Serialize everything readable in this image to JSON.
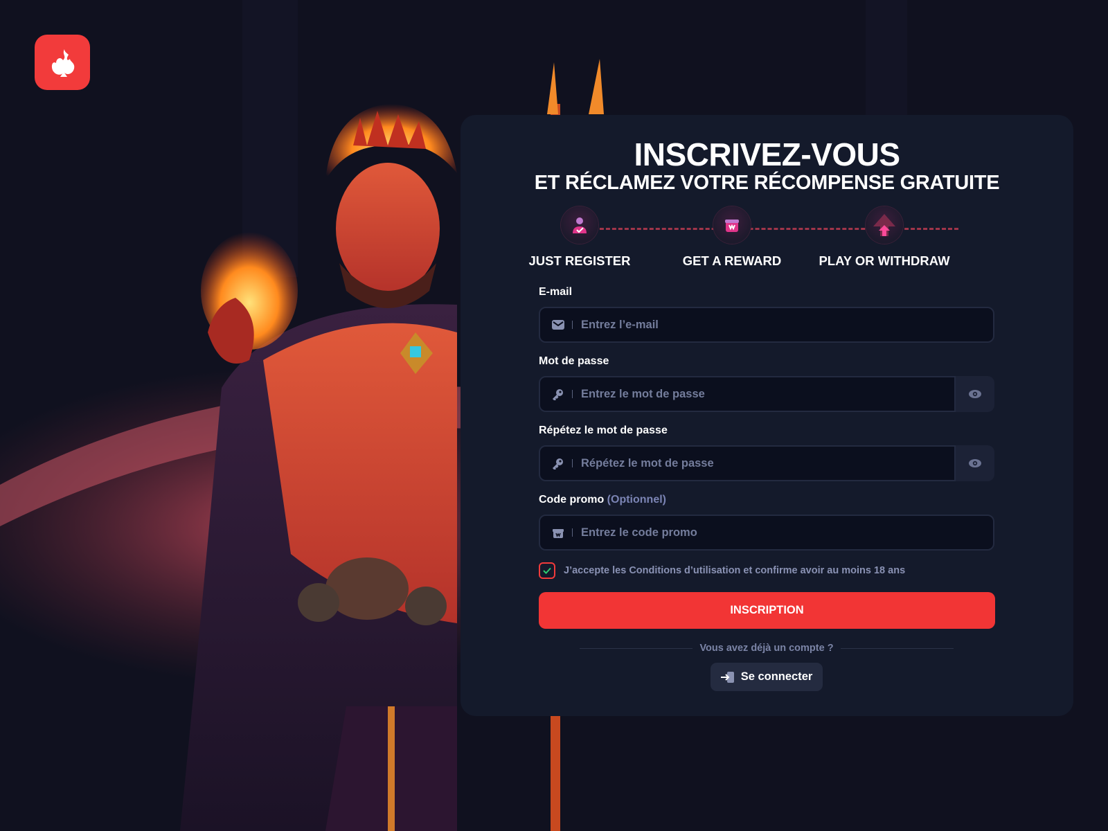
{
  "header": {
    "logo_icon": "flame-spade-logo-icon"
  },
  "signup": {
    "title": "INSCRIVEZ-VOUS",
    "subtitle": "ET RÉCLAMEZ VOTRE RÉCOMPENSE GRATUITE",
    "steps": [
      {
        "label": "JUST REGISTER",
        "icon": "user-check-icon"
      },
      {
        "label": "GET A REWARD",
        "icon": "gift-box-icon"
      },
      {
        "label": "PLAY OR WITHDRAW",
        "icon": "arrow-up-icon"
      }
    ],
    "email": {
      "label": "E-mail",
      "placeholder": "Entrez l’e-mail",
      "icon": "envelope-icon"
    },
    "password": {
      "label": "Mot de passe",
      "placeholder": "Entrez le mot de passe",
      "icon": "key-icon",
      "toggle_icon": "eye-icon"
    },
    "password_repeat": {
      "label": "Répétez le mot de passe",
      "placeholder": "Répétez le mot de passe",
      "icon": "key-icon",
      "toggle_icon": "eye-icon"
    },
    "promo": {
      "label": "Code promo",
      "optional": "(Optionnel)",
      "placeholder": "Entrez le code promo",
      "icon": "gift-icon"
    },
    "terms": {
      "text": "J’accepte les Conditions d’utilisation et confirme avoir au moins 18 ans",
      "checked": true
    },
    "submit_label": "INSCRIPTION",
    "have_account": "Vous avez déjà un compte ?",
    "login_label": "Se connecter"
  },
  "colors": {
    "accent": "#f23535",
    "card": "#141a2b",
    "input_bg": "#0b0f1e",
    "step_dash": "#a0354a"
  }
}
